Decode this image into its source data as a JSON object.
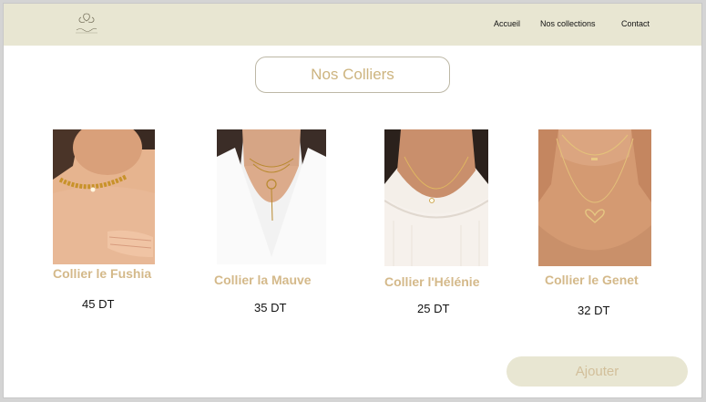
{
  "nav": {
    "home": "Accueil",
    "collections": "Nos collections",
    "contact": "Contact"
  },
  "section_title": "Nos Colliers",
  "products": [
    {
      "name": "Collier le Fushia",
      "price": "45 DT",
      "image": "gold-choker-necklace-photo"
    },
    {
      "name": "Collier la Mauve",
      "price": "35 DT",
      "image": "layered-lariat-necklace-photo"
    },
    {
      "name": "Collier l'Hélénie",
      "price": "25 DT",
      "image": "pendant-chain-necklace-photo"
    },
    {
      "name": "Collier le Genet",
      "price": "32 DT",
      "image": "double-heart-necklace-photo"
    }
  ],
  "add_button": "Ajouter",
  "colors": {
    "header_bg": "#e8e6d2",
    "accent": "#d4b98a",
    "title_text": "#cdb47f"
  }
}
